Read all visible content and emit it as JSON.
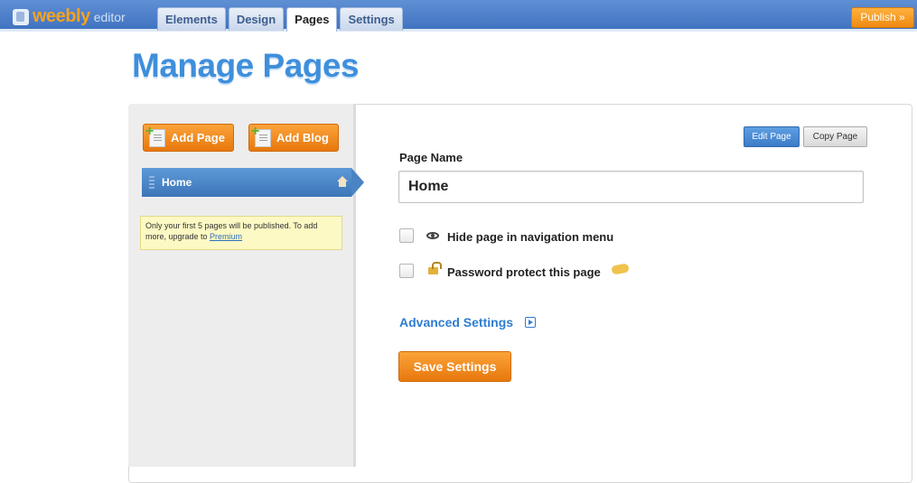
{
  "app": {
    "logo_text": "weebly",
    "logo_subtext": "editor"
  },
  "nav": {
    "tabs": [
      {
        "label": "Elements",
        "active": false
      },
      {
        "label": "Design",
        "active": false
      },
      {
        "label": "Pages",
        "active": true
      },
      {
        "label": "Settings",
        "active": false
      }
    ],
    "publish_label": "Publish »"
  },
  "page_title": "Manage Pages",
  "sidebar": {
    "add_page_label": "Add Page",
    "add_blog_label": "Add Blog",
    "pages": [
      {
        "label": "Home",
        "selected": true
      }
    ],
    "notice_text": "Only your first 5 pages will be published. To add more, upgrade to ",
    "notice_link": "Premium"
  },
  "editor": {
    "edit_page_label": "Edit Page",
    "copy_page_label": "Copy Page",
    "page_name_label": "Page Name",
    "page_name_value": "Home",
    "hide_nav_label": "Hide page in navigation menu",
    "hide_nav_checked": false,
    "password_label": "Password protect this page",
    "password_checked": false,
    "advanced_label": "Advanced Settings",
    "save_label": "Save Settings"
  },
  "colors": {
    "accent_orange": "#f08a16",
    "accent_blue": "#3f8fdb",
    "notice_bg": "#fdf9c4"
  }
}
